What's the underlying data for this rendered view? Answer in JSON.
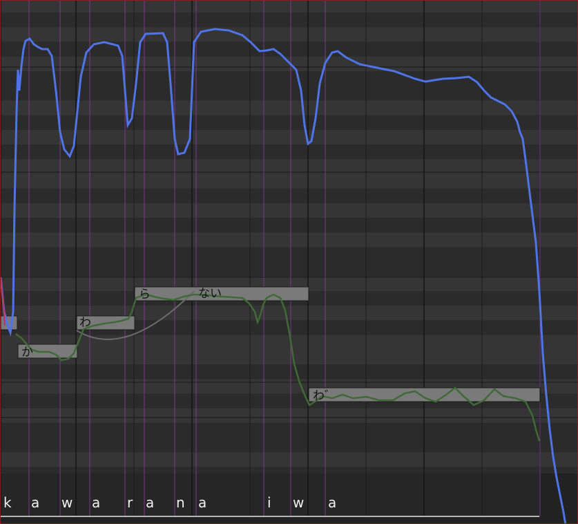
{
  "colors": {
    "pitch_curve": "#4f74e8",
    "vocal_curve": "#3e6b35",
    "note_fill": "#7a7a7a",
    "phoneme_line": "#7a3a86"
  },
  "notes": [
    {
      "lyric": ""
    },
    {
      "lyric": "か"
    },
    {
      "lyric": "わ"
    },
    {
      "lyric": "ら"
    },
    {
      "lyric": "ない"
    },
    {
      "lyric": "わ゛"
    }
  ],
  "phonemes": [
    "k",
    "a",
    "w",
    "a",
    "r",
    "a",
    "n",
    "a",
    "i",
    "w",
    "a"
  ]
}
